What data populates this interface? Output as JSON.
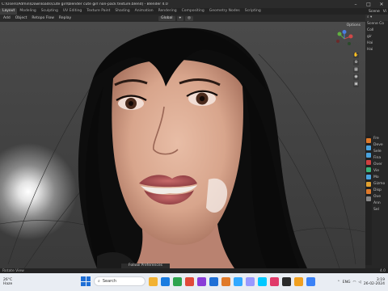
{
  "window": {
    "title": "C:\\Users\\Admin\\Downloads\\cute girl\\blender cute girl non-pack texture.blend] - Blender 4.0",
    "controls": [
      "–",
      "□",
      "✕"
    ]
  },
  "menubar": {
    "tabs": [
      "Layout",
      "Modeling",
      "Sculpting",
      "UV Editing",
      "Texture Paint",
      "Shading",
      "Animation",
      "Rendering",
      "Compositing",
      "Geometry Nodes",
      "Scripting"
    ],
    "active_tab": "Layout",
    "scene_label": "Scene",
    "view_layer": "Vi"
  },
  "toolbar": {
    "items": [
      "Add",
      "Object",
      "Retopo Flow",
      "Replay"
    ],
    "transform": "Global"
  },
  "viewport": {
    "options_label": "Options",
    "nav_icons": [
      "✋",
      "⊕",
      "▦",
      "◉",
      "▣"
    ],
    "bottom_tab": "Follow Preferences"
  },
  "outliner": {
    "rows": [
      "Scene Co",
      "Coll",
      "gir",
      "Hai",
      "Hai"
    ]
  },
  "properties": {
    "rows": [
      "Fre",
      "Deve",
      "Sele",
      "Fina",
      "Over",
      "Vie",
      "Mo",
      "Gizmo",
      "Disp",
      "Ove",
      "Ann",
      "Sel"
    ],
    "icon_colors": [
      "#e07a2a",
      "#4aa3df",
      "#4aa3df",
      "#d04040",
      "#3bb27a",
      "#4aa3df",
      "#e0a030",
      "#e07a2a",
      "#888888"
    ]
  },
  "statusbar": {
    "left": "Rotate View",
    "right": "4.0"
  },
  "taskbar": {
    "weather_temp": "26°C",
    "weather_desc": "Haze",
    "search_placeholder": "Search",
    "app_colors": [
      "#f2b233",
      "#1a7ce0",
      "#2ea44f",
      "#e04a3a",
      "#8a3cd8",
      "#1f6fd6",
      "#e07a2a",
      "#31a8ff",
      "#9999ff",
      "#00c8ff",
      "#e03a6a",
      "#2a2a2a",
      "#f0a020",
      "#3b82f6"
    ],
    "lang": "ENG",
    "time": "3:19",
    "date": "26-02-2024"
  }
}
